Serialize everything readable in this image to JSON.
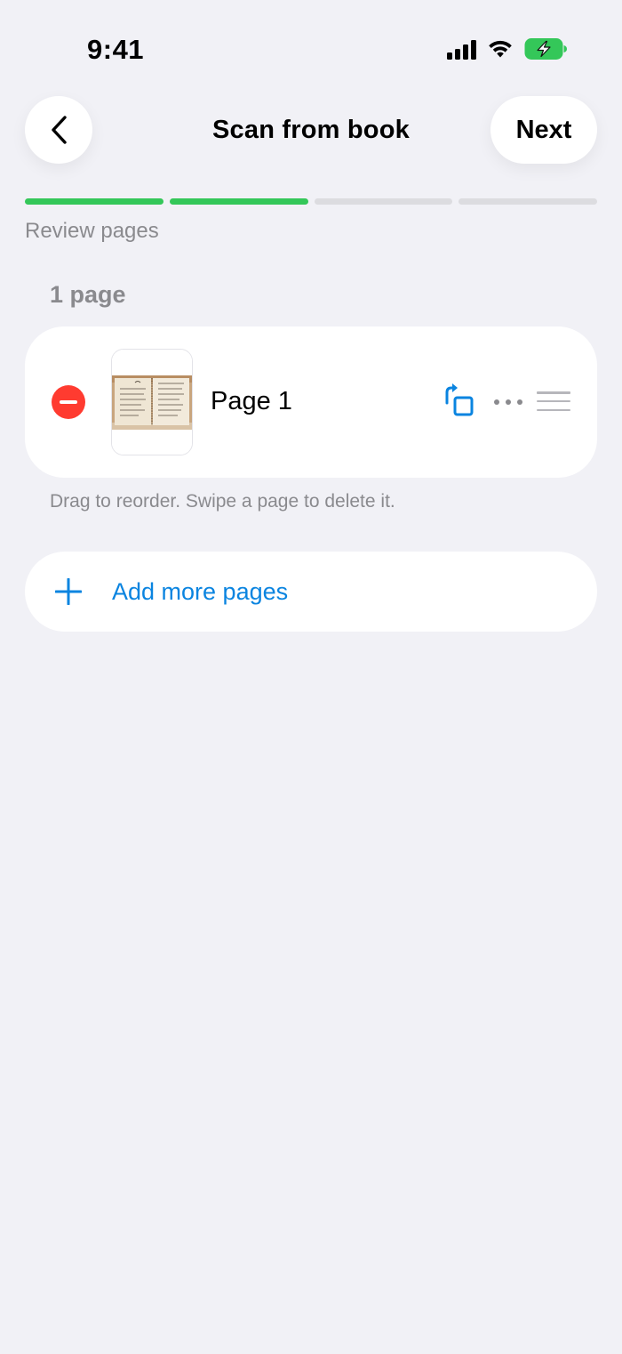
{
  "status_bar": {
    "time": "9:41",
    "icons": [
      "cellular-signal-icon",
      "wifi-icon",
      "battery-charging-icon"
    ]
  },
  "header": {
    "back_icon": "chevron-left-icon",
    "title": "Scan from book",
    "next_label": "Next"
  },
  "progress": {
    "total_steps": 4,
    "completed_steps": 2,
    "active_color": "#34C759",
    "inactive_color": "#DCDCE0"
  },
  "step_label": "Review pages",
  "page_count_label": "1 page",
  "pages": [
    {
      "name": "Page 1",
      "delete_icon": "minus-circle-icon",
      "thumbnail": "open-book-photo",
      "rotate_icon": "rotate-page-icon",
      "more_icon": "ellipsis-icon",
      "drag_icon": "drag-handle-icon"
    }
  ],
  "hint": "Drag to reorder. Swipe a page to delete it.",
  "add_pages": {
    "icon": "plus-icon",
    "label": "Add more pages"
  },
  "colors": {
    "background": "#F1F1F6",
    "accent": "#0A84E0",
    "destructive": "#FF3B30",
    "secondary_text": "#8A8A8E"
  }
}
